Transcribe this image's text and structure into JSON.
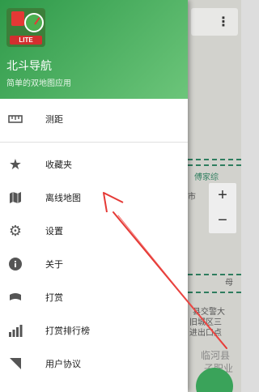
{
  "drawer": {
    "app_title": "北斗导航",
    "app_subtitle": "简单的双地图应用",
    "logo_badge": "LITE",
    "items": [
      {
        "label": "测距",
        "icon": "ruler-icon"
      },
      {
        "label": "收藏夹",
        "icon": "star-icon"
      },
      {
        "label": "离线地图",
        "icon": "map-icon"
      },
      {
        "label": "设置",
        "icon": "gear-icon"
      },
      {
        "label": "关于",
        "icon": "info-icon"
      },
      {
        "label": "打赏",
        "icon": "money-icon"
      },
      {
        "label": "打赏排行榜",
        "icon": "bar-chart-icon"
      },
      {
        "label": "用户协议",
        "icon": "document-icon"
      }
    ]
  },
  "map": {
    "zoom_in": "+",
    "zoom_out": "−",
    "labels": [
      "傅家综",
      "市",
      "母",
      "县交警大",
      "旧城区三",
      "进出口点",
      "临河县",
      "子职业"
    ]
  },
  "colors": {
    "header_start": "#2f9a4a",
    "header_end": "#6cc57a",
    "annotation_arrow": "#e53935"
  }
}
